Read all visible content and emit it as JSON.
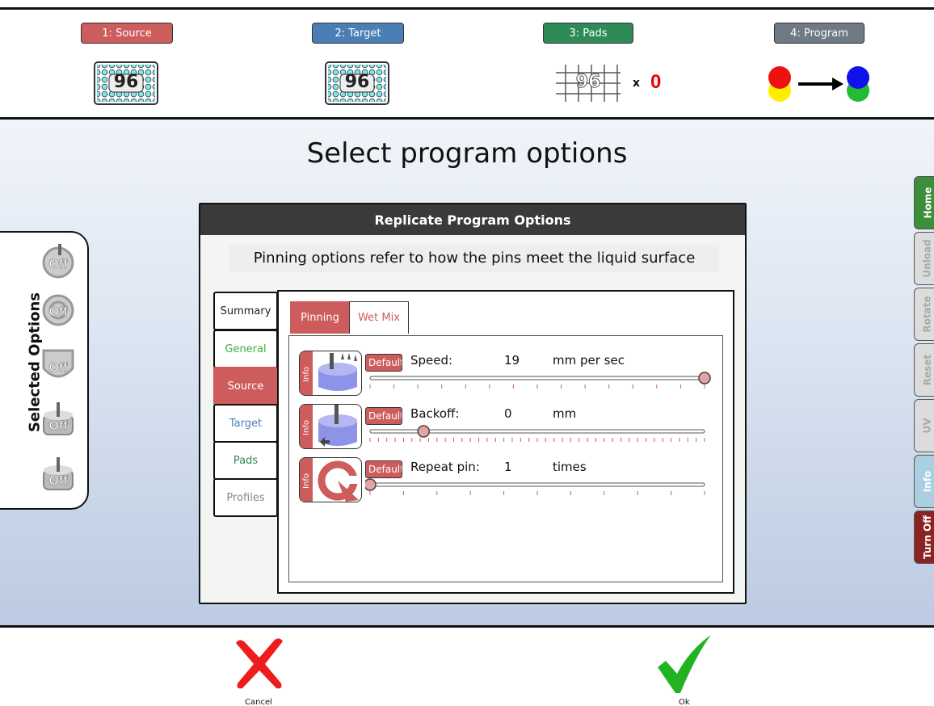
{
  "steps": [
    {
      "label": "1: Source",
      "color": "#cd5c5c"
    },
    {
      "label": "2: Target",
      "color": "#4a7fb5"
    },
    {
      "label": "3: Pads",
      "color": "#2e8b57"
    },
    {
      "label": "4: Program",
      "color": "#6f7a85"
    }
  ],
  "plates": {
    "source_number": "96",
    "target_number": "96",
    "pads_number": "96"
  },
  "pads": {
    "multiplier": "x",
    "count": "0"
  },
  "page_title": "Select program options",
  "selected_options": {
    "label": "Selected Options",
    "icon_badge": "Off"
  },
  "side_tabs": [
    {
      "label": "Home",
      "bg": "#3b8f3b",
      "fg": "#ffffff"
    },
    {
      "label": "Unload",
      "bg": "#dcdcdc",
      "fg": "#aaaaaa"
    },
    {
      "label": "Rotate",
      "bg": "#dcdcdc",
      "fg": "#aaaaaa"
    },
    {
      "label": "Reset",
      "bg": "#dcdcdc",
      "fg": "#aaaaaa"
    },
    {
      "label": "UV",
      "bg": "#dcdcdc",
      "fg": "#aaaaaa"
    },
    {
      "label": "Info",
      "bg": "#a9cfe0",
      "fg": "#ffffff"
    },
    {
      "label": "Turn Off",
      "bg": "#8b2323",
      "fg": "#ffffff"
    }
  ],
  "dialog": {
    "title": "Replicate Program Options",
    "hint": "Pinning options refer to how the pins meet the liquid surface",
    "vertical_tabs": [
      {
        "label": "Summary",
        "color": "#222222"
      },
      {
        "label": "General",
        "color": "#3cb043"
      },
      {
        "label": "Source",
        "color": "#ffffff"
      },
      {
        "label": "Target",
        "color": "#4a7fb5"
      },
      {
        "label": "Pads",
        "color": "#2e8b57"
      },
      {
        "label": "Profiles",
        "color": "#888888"
      }
    ],
    "tabs": [
      {
        "label": "Pinning"
      },
      {
        "label": "Wet Mix"
      }
    ],
    "info_label": "Info",
    "default_label": "Default",
    "options": [
      {
        "label": "Speed:",
        "value": "19",
        "unit": "mm per sec",
        "fraction": 1.0,
        "ticks": 14
      },
      {
        "label": "Backoff:",
        "value": "0",
        "unit": "mm",
        "fraction": 0.16,
        "ticks": 40
      },
      {
        "label": "Repeat pin:",
        "value": "1",
        "unit": "times",
        "fraction": 0.0,
        "ticks": 10
      }
    ]
  },
  "actions": {
    "cancel_label": "Cancel",
    "ok_label": "Ok"
  },
  "colors": {
    "accent": "#cd5c5c",
    "dark": "#3a3a3a",
    "cancel": "#ee1c1c",
    "ok": "#22b322"
  }
}
